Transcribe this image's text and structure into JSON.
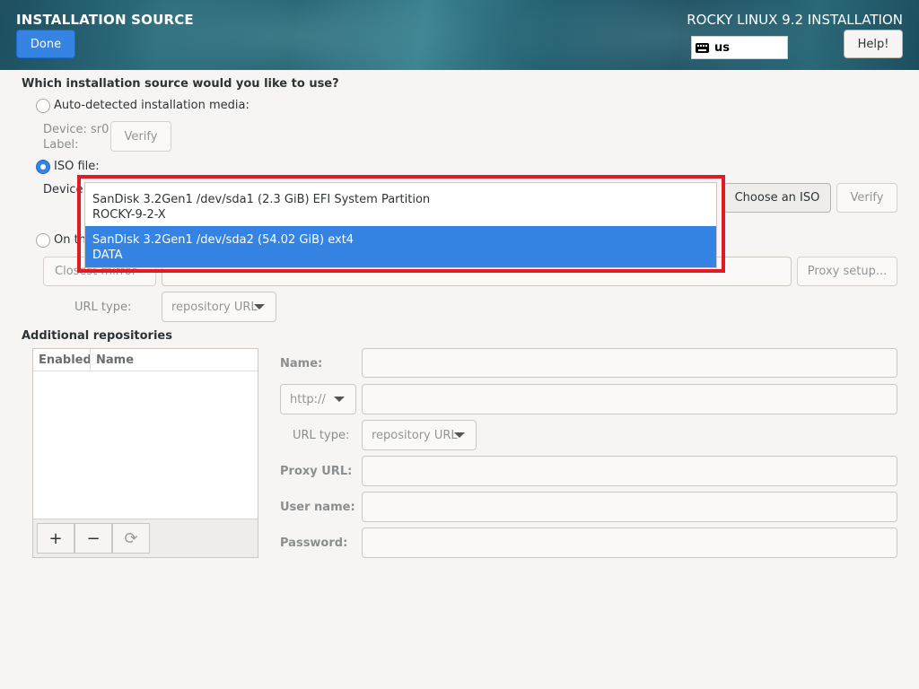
{
  "header": {
    "spoke_title": "INSTALLATION SOURCE",
    "done_label": "Done",
    "product_title": "ROCKY LINUX 9.2 INSTALLATION",
    "keyboard_layout": "us",
    "help_label": "Help!"
  },
  "source": {
    "question": "Which installation source would you like to use?",
    "auto_detected_label": "Auto-detected installation media:",
    "device_label": "Device: sr0",
    "label_label": "Label:",
    "verify_label": "Verify",
    "iso_label": "ISO file:",
    "iso_device_label": "Device",
    "choose_iso_label": "Choose an ISO",
    "iso_verify_label": "Verify",
    "network_label": "On th",
    "mirror_label": "Closest mirror",
    "proxy_setup_label": "Proxy setup...",
    "url_type_label": "URL type:",
    "url_type_value": "repository URL"
  },
  "iso_device_options": [
    {
      "line1": "SanDisk 3.2Gen1 /dev/sda1 (2.3 GiB) EFI System Partition",
      "line2": "ROCKY-9-2-X",
      "selected": false
    },
    {
      "line1": "SanDisk 3.2Gen1 /dev/sda2 (54.02 GiB) ext4",
      "line2": "DATA",
      "selected": true
    }
  ],
  "repos": {
    "title": "Additional repositories",
    "col_enabled": "Enabled",
    "col_name": "Name",
    "add_label": "+",
    "remove_label": "−",
    "revert_label": "⟳",
    "name_label": "Name:",
    "protocol_value": "http://",
    "url_type_label": "URL type:",
    "url_type_value": "repository URL",
    "proxy_url_label": "Proxy URL:",
    "user_name_label": "User name:",
    "password_label": "Password:"
  },
  "colors": {
    "accent": "#3584e4",
    "highlight_frame": "#e01b24"
  }
}
